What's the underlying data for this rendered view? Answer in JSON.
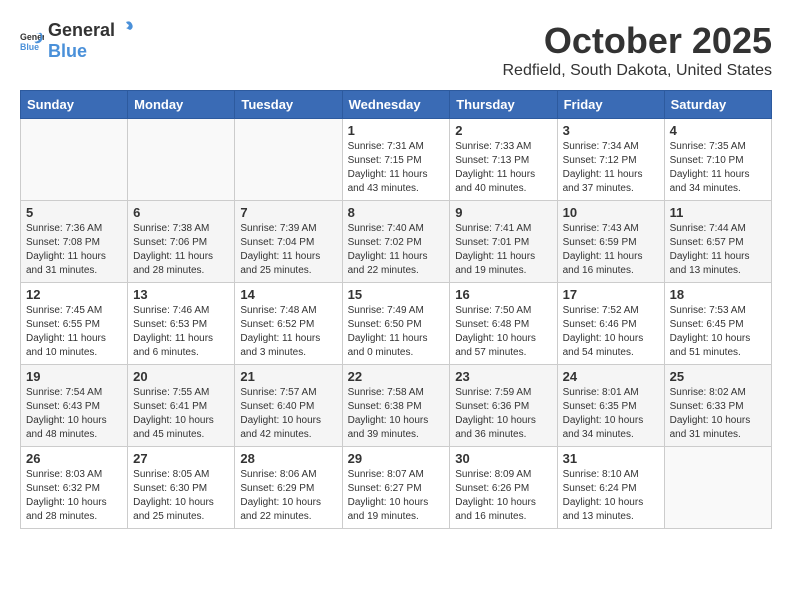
{
  "logo": {
    "general": "General",
    "blue": "Blue"
  },
  "header": {
    "month": "October 2025",
    "location": "Redfield, South Dakota, United States"
  },
  "weekdays": [
    "Sunday",
    "Monday",
    "Tuesday",
    "Wednesday",
    "Thursday",
    "Friday",
    "Saturday"
  ],
  "weeks": [
    [
      {
        "day": "",
        "info": ""
      },
      {
        "day": "",
        "info": ""
      },
      {
        "day": "",
        "info": ""
      },
      {
        "day": "1",
        "info": "Sunrise: 7:31 AM\nSunset: 7:15 PM\nDaylight: 11 hours and 43 minutes."
      },
      {
        "day": "2",
        "info": "Sunrise: 7:33 AM\nSunset: 7:13 PM\nDaylight: 11 hours and 40 minutes."
      },
      {
        "day": "3",
        "info": "Sunrise: 7:34 AM\nSunset: 7:12 PM\nDaylight: 11 hours and 37 minutes."
      },
      {
        "day": "4",
        "info": "Sunrise: 7:35 AM\nSunset: 7:10 PM\nDaylight: 11 hours and 34 minutes."
      }
    ],
    [
      {
        "day": "5",
        "info": "Sunrise: 7:36 AM\nSunset: 7:08 PM\nDaylight: 11 hours and 31 minutes."
      },
      {
        "day": "6",
        "info": "Sunrise: 7:38 AM\nSunset: 7:06 PM\nDaylight: 11 hours and 28 minutes."
      },
      {
        "day": "7",
        "info": "Sunrise: 7:39 AM\nSunset: 7:04 PM\nDaylight: 11 hours and 25 minutes."
      },
      {
        "day": "8",
        "info": "Sunrise: 7:40 AM\nSunset: 7:02 PM\nDaylight: 11 hours and 22 minutes."
      },
      {
        "day": "9",
        "info": "Sunrise: 7:41 AM\nSunset: 7:01 PM\nDaylight: 11 hours and 19 minutes."
      },
      {
        "day": "10",
        "info": "Sunrise: 7:43 AM\nSunset: 6:59 PM\nDaylight: 11 hours and 16 minutes."
      },
      {
        "day": "11",
        "info": "Sunrise: 7:44 AM\nSunset: 6:57 PM\nDaylight: 11 hours and 13 minutes."
      }
    ],
    [
      {
        "day": "12",
        "info": "Sunrise: 7:45 AM\nSunset: 6:55 PM\nDaylight: 11 hours and 10 minutes."
      },
      {
        "day": "13",
        "info": "Sunrise: 7:46 AM\nSunset: 6:53 PM\nDaylight: 11 hours and 6 minutes."
      },
      {
        "day": "14",
        "info": "Sunrise: 7:48 AM\nSunset: 6:52 PM\nDaylight: 11 hours and 3 minutes."
      },
      {
        "day": "15",
        "info": "Sunrise: 7:49 AM\nSunset: 6:50 PM\nDaylight: 11 hours and 0 minutes."
      },
      {
        "day": "16",
        "info": "Sunrise: 7:50 AM\nSunset: 6:48 PM\nDaylight: 10 hours and 57 minutes."
      },
      {
        "day": "17",
        "info": "Sunrise: 7:52 AM\nSunset: 6:46 PM\nDaylight: 10 hours and 54 minutes."
      },
      {
        "day": "18",
        "info": "Sunrise: 7:53 AM\nSunset: 6:45 PM\nDaylight: 10 hours and 51 minutes."
      }
    ],
    [
      {
        "day": "19",
        "info": "Sunrise: 7:54 AM\nSunset: 6:43 PM\nDaylight: 10 hours and 48 minutes."
      },
      {
        "day": "20",
        "info": "Sunrise: 7:55 AM\nSunset: 6:41 PM\nDaylight: 10 hours and 45 minutes."
      },
      {
        "day": "21",
        "info": "Sunrise: 7:57 AM\nSunset: 6:40 PM\nDaylight: 10 hours and 42 minutes."
      },
      {
        "day": "22",
        "info": "Sunrise: 7:58 AM\nSunset: 6:38 PM\nDaylight: 10 hours and 39 minutes."
      },
      {
        "day": "23",
        "info": "Sunrise: 7:59 AM\nSunset: 6:36 PM\nDaylight: 10 hours and 36 minutes."
      },
      {
        "day": "24",
        "info": "Sunrise: 8:01 AM\nSunset: 6:35 PM\nDaylight: 10 hours and 34 minutes."
      },
      {
        "day": "25",
        "info": "Sunrise: 8:02 AM\nSunset: 6:33 PM\nDaylight: 10 hours and 31 minutes."
      }
    ],
    [
      {
        "day": "26",
        "info": "Sunrise: 8:03 AM\nSunset: 6:32 PM\nDaylight: 10 hours and 28 minutes."
      },
      {
        "day": "27",
        "info": "Sunrise: 8:05 AM\nSunset: 6:30 PM\nDaylight: 10 hours and 25 minutes."
      },
      {
        "day": "28",
        "info": "Sunrise: 8:06 AM\nSunset: 6:29 PM\nDaylight: 10 hours and 22 minutes."
      },
      {
        "day": "29",
        "info": "Sunrise: 8:07 AM\nSunset: 6:27 PM\nDaylight: 10 hours and 19 minutes."
      },
      {
        "day": "30",
        "info": "Sunrise: 8:09 AM\nSunset: 6:26 PM\nDaylight: 10 hours and 16 minutes."
      },
      {
        "day": "31",
        "info": "Sunrise: 8:10 AM\nSunset: 6:24 PM\nDaylight: 10 hours and 13 minutes."
      },
      {
        "day": "",
        "info": ""
      }
    ]
  ]
}
